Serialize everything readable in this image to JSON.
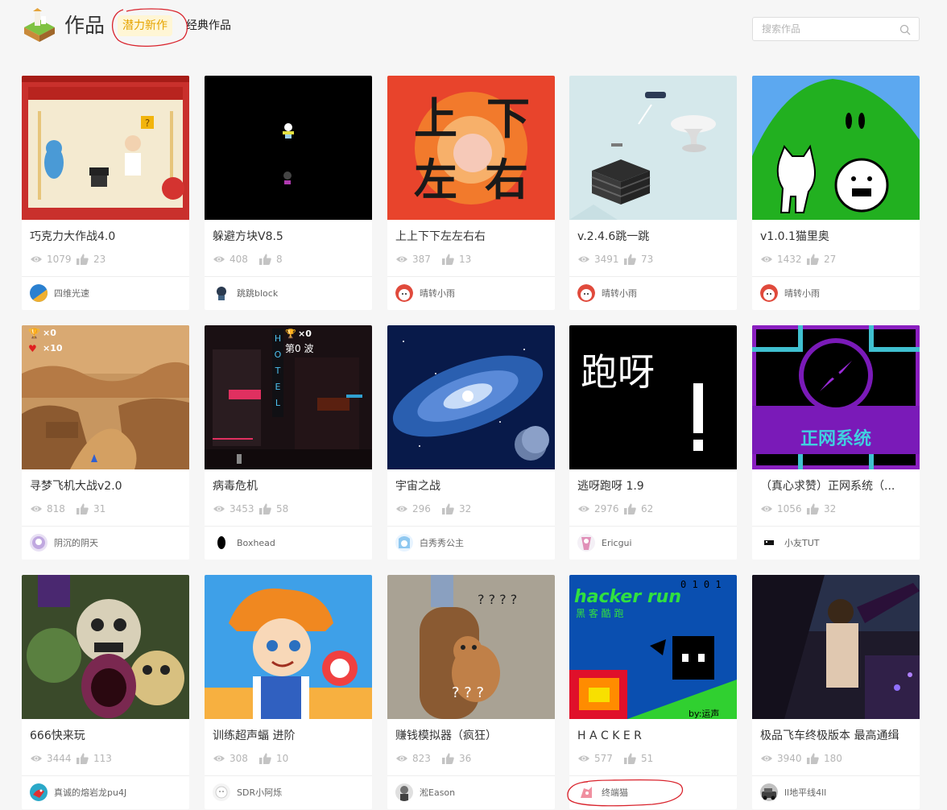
{
  "header": {
    "title": "作品",
    "tabs": [
      {
        "label": "潜力新作",
        "active": true
      },
      {
        "label": "经典作品",
        "active": false
      }
    ],
    "search": {
      "placeholder": "搜索作品",
      "value": ""
    },
    "icons": [
      "logo-icon",
      "search-icon"
    ]
  },
  "colors": {
    "accent": "#e6a400",
    "accent_bg": "#fff6d5",
    "annotation": "#d9232c",
    "stat_gray": "#b5b5b5"
  },
  "works": [
    {
      "title": "巧克力大作战4.0",
      "views": "1079",
      "likes": "23",
      "author": "四维光速",
      "thumb": "chocolate-war",
      "avatar": "avatar-blue"
    },
    {
      "title": "躲避方块V8.5",
      "views": "408",
      "likes": "8",
      "author": "跳跳block",
      "thumb": "dodge-blocks",
      "avatar": "avatar-dark"
    },
    {
      "title": "上上下下左左右右",
      "views": "387",
      "likes": "13",
      "author": "晴转小雨",
      "thumb": "fire-text",
      "avatar": "avatar-red"
    },
    {
      "title": "v.2.4.6跳一跳",
      "views": "3491",
      "likes": "73",
      "author": "晴转小雨",
      "thumb": "jump-jump",
      "avatar": "avatar-red"
    },
    {
      "title": "v1.0.1猫里奥",
      "views": "1432",
      "likes": "27",
      "author": "晴转小雨",
      "thumb": "cat-mario",
      "avatar": "avatar-red"
    },
    {
      "title": "寻梦飞机大战v2.0",
      "views": "818",
      "likes": "31",
      "author": "阴沉的阴天",
      "thumb": "canyon",
      "avatar": "avatar-purple"
    },
    {
      "title": "病毒危机",
      "views": "3453",
      "likes": "58",
      "author": "Boxhead",
      "thumb": "neon-city",
      "avatar": "avatar-black-egg"
    },
    {
      "title": "宇宙之战",
      "views": "296",
      "likes": "32",
      "author": "白秀秀公主",
      "thumb": "galaxy",
      "avatar": "avatar-anime"
    },
    {
      "title": "逃呀跑呀 1.9",
      "views": "2976",
      "likes": "62",
      "author": "Ericgui",
      "thumb": "run-text",
      "avatar": "avatar-pink"
    },
    {
      "title": "（真心求赞）正网系统（...",
      "views": "1056",
      "likes": "32",
      "author": "小友TUT",
      "thumb": "compass",
      "avatar": "avatar-bw"
    },
    {
      "title": "666快来玩",
      "views": "3444",
      "likes": "113",
      "author": "真诚的熔岩龙pu4J",
      "thumb": "monsters",
      "avatar": "avatar-bird"
    },
    {
      "title": "训练超声蝠 进阶",
      "views": "308",
      "likes": "10",
      "author": "SDR小阿烁",
      "thumb": "anime-boy",
      "avatar": "avatar-white"
    },
    {
      "title": "赚钱模拟器（疯狂）",
      "views": "823",
      "likes": "36",
      "author": "淞Eason",
      "thumb": "jerry",
      "avatar": "avatar-gray"
    },
    {
      "title": "H A C K E R",
      "views": "577",
      "likes": "51",
      "author": "终端猫",
      "thumb": "hacker-run",
      "avatar": "avatar-cat"
    },
    {
      "title": "极品飞车终极版本 最高通缉",
      "views": "3940",
      "likes": "180",
      "author": "ll地平线4ll",
      "thumb": "street",
      "avatar": "avatar-car"
    }
  ],
  "thumb_text": {
    "fire-text": [
      "上",
      "下",
      "左",
      "右"
    ],
    "run-text": [
      "跑呀",
      "!"
    ],
    "compass": "正网系统",
    "hacker-run": [
      "hacker run",
      "黑 客 酷 跑",
      "by:运声"
    ],
    "neon-city": [
      "×0",
      "第0 波",
      "HOTEL"
    ],
    "canyon": [
      "×0",
      "×10"
    ],
    "jerry": "? ? ? ?"
  }
}
